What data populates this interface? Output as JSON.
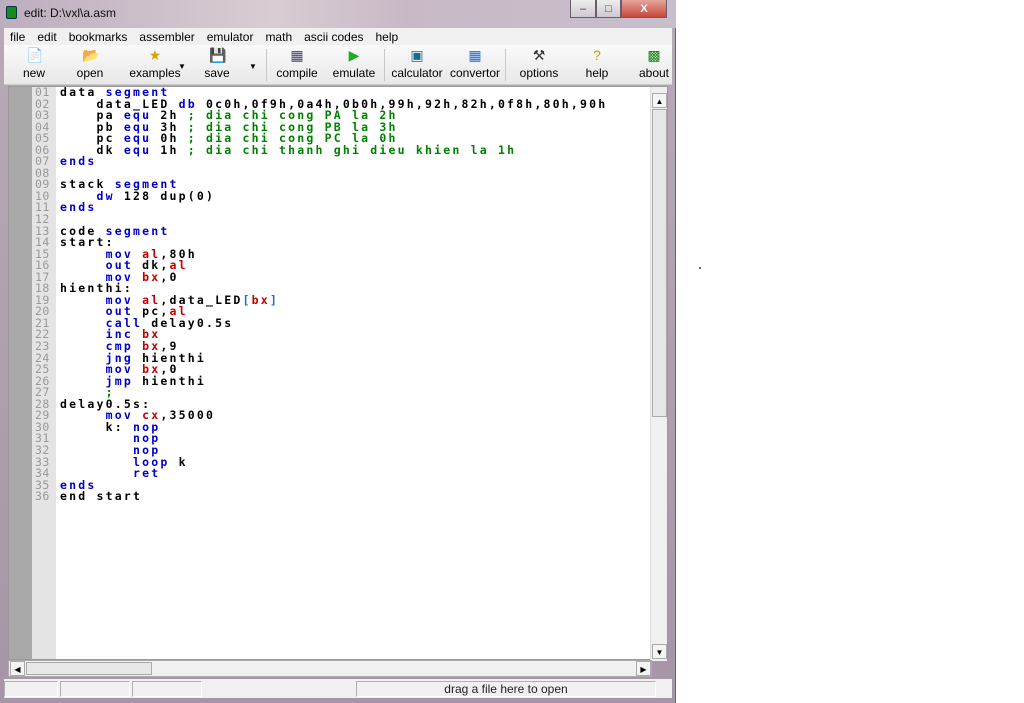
{
  "window": {
    "title": "edit: D:\\vxl\\a.asm",
    "minimize": "–",
    "maximize": "□",
    "close": "X"
  },
  "menu": [
    "file",
    "edit",
    "bookmarks",
    "assembler",
    "emulator",
    "math",
    "ascii codes",
    "help"
  ],
  "toolbar": [
    {
      "label": "new",
      "icon": "📄"
    },
    {
      "label": "open",
      "icon": "📂"
    },
    {
      "label": "examples",
      "icon": "★"
    },
    {
      "label": "save",
      "icon": "💾"
    },
    {
      "label": "compile",
      "icon": "▦"
    },
    {
      "label": "emulate",
      "icon": "▶"
    },
    {
      "label": "calculator",
      "icon": "▣"
    },
    {
      "label": "convertor",
      "icon": "▦"
    },
    {
      "label": "options",
      "icon": "⚒"
    },
    {
      "label": "help",
      "icon": "?"
    },
    {
      "label": "about",
      "icon": "▩"
    }
  ],
  "status": {
    "hint": "drag a file here to open"
  },
  "code": [
    [
      [
        "plain",
        "data "
      ],
      [
        "kw",
        "segment"
      ]
    ],
    [
      [
        "plain",
        "    data_LED "
      ],
      [
        "kw",
        "db"
      ],
      [
        "plain",
        " 0c0h,0f9h,0a4h,0b0h,99h,92h,82h,0f8h,80h,90h"
      ]
    ],
    [
      [
        "plain",
        "    pa "
      ],
      [
        "kw",
        "equ"
      ],
      [
        "plain",
        " 2h "
      ],
      [
        "cm",
        "; dia chi cong PA la 2h"
      ]
    ],
    [
      [
        "plain",
        "    pb "
      ],
      [
        "kw",
        "equ"
      ],
      [
        "plain",
        " 3h "
      ],
      [
        "cm",
        "; dia chi cong PB la 3h"
      ]
    ],
    [
      [
        "plain",
        "    pc "
      ],
      [
        "kw",
        "equ"
      ],
      [
        "plain",
        " 0h "
      ],
      [
        "cm",
        "; dia chi cong PC la 0h"
      ]
    ],
    [
      [
        "plain",
        "    dk "
      ],
      [
        "kw",
        "equ"
      ],
      [
        "plain",
        " 1h "
      ],
      [
        "cm",
        "; dia chi thanh ghi dieu khien la 1h"
      ]
    ],
    [
      [
        "kw",
        "ends"
      ]
    ],
    [],
    [
      [
        "plain",
        "stack "
      ],
      [
        "kw",
        "segment"
      ]
    ],
    [
      [
        "plain",
        "    "
      ],
      [
        "kw",
        "dw"
      ],
      [
        "plain",
        " 128 dup(0)"
      ]
    ],
    [
      [
        "kw",
        "ends"
      ]
    ],
    [],
    [
      [
        "plain",
        "code "
      ],
      [
        "kw",
        "segment"
      ]
    ],
    [
      [
        "plain",
        "start:"
      ]
    ],
    [
      [
        "plain",
        "     "
      ],
      [
        "kw",
        "mov"
      ],
      [
        "plain",
        " "
      ],
      [
        "reg",
        "al"
      ],
      [
        "plain",
        ",80h"
      ]
    ],
    [
      [
        "plain",
        "     "
      ],
      [
        "kw",
        "out"
      ],
      [
        "plain",
        " dk,"
      ],
      [
        "reg",
        "al"
      ]
    ],
    [
      [
        "plain",
        "     "
      ],
      [
        "kw",
        "mov"
      ],
      [
        "plain",
        " "
      ],
      [
        "reg",
        "bx"
      ],
      [
        "plain",
        ",0"
      ]
    ],
    [
      [
        "plain",
        "hienthi:"
      ]
    ],
    [
      [
        "plain",
        "     "
      ],
      [
        "kw",
        "mov"
      ],
      [
        "plain",
        " "
      ],
      [
        "reg",
        "al"
      ],
      [
        "plain",
        ",data_LED"
      ],
      [
        "br",
        "["
      ],
      [
        "reg",
        "bx"
      ],
      [
        "br",
        "]"
      ]
    ],
    [
      [
        "plain",
        "     "
      ],
      [
        "kw",
        "out"
      ],
      [
        "plain",
        " pc,"
      ],
      [
        "reg",
        "al"
      ]
    ],
    [
      [
        "plain",
        "     "
      ],
      [
        "kw",
        "call"
      ],
      [
        "plain",
        " delay0.5s"
      ]
    ],
    [
      [
        "plain",
        "     "
      ],
      [
        "kw",
        "inc"
      ],
      [
        "plain",
        " "
      ],
      [
        "reg",
        "bx"
      ]
    ],
    [
      [
        "plain",
        "     "
      ],
      [
        "kw",
        "cmp"
      ],
      [
        "plain",
        " "
      ],
      [
        "reg",
        "bx"
      ],
      [
        "plain",
        ",9"
      ]
    ],
    [
      [
        "plain",
        "     "
      ],
      [
        "kw",
        "jng"
      ],
      [
        "plain",
        " hienthi"
      ]
    ],
    [
      [
        "plain",
        "     "
      ],
      [
        "kw",
        "mov"
      ],
      [
        "plain",
        " "
      ],
      [
        "reg",
        "bx"
      ],
      [
        "plain",
        ",0"
      ]
    ],
    [
      [
        "plain",
        "     "
      ],
      [
        "kw",
        "jmp"
      ],
      [
        "plain",
        " hienthi"
      ]
    ],
    [
      [
        "plain",
        "     "
      ],
      [
        "cm",
        ";"
      ]
    ],
    [
      [
        "plain",
        "delay0.5s:"
      ]
    ],
    [
      [
        "plain",
        "     "
      ],
      [
        "kw",
        "mov"
      ],
      [
        "plain",
        " "
      ],
      [
        "reg",
        "cx"
      ],
      [
        "plain",
        ",35000"
      ]
    ],
    [
      [
        "plain",
        "     k: "
      ],
      [
        "kw",
        "nop"
      ]
    ],
    [
      [
        "plain",
        "        "
      ],
      [
        "kw",
        "nop"
      ]
    ],
    [
      [
        "plain",
        "        "
      ],
      [
        "kw",
        "nop"
      ]
    ],
    [
      [
        "plain",
        "        "
      ],
      [
        "kw",
        "loop"
      ],
      [
        "plain",
        " k"
      ]
    ],
    [
      [
        "plain",
        "        "
      ],
      [
        "kw",
        "ret"
      ]
    ],
    [
      [
        "kw",
        "ends"
      ]
    ],
    [
      [
        "plain",
        "end start"
      ]
    ]
  ]
}
